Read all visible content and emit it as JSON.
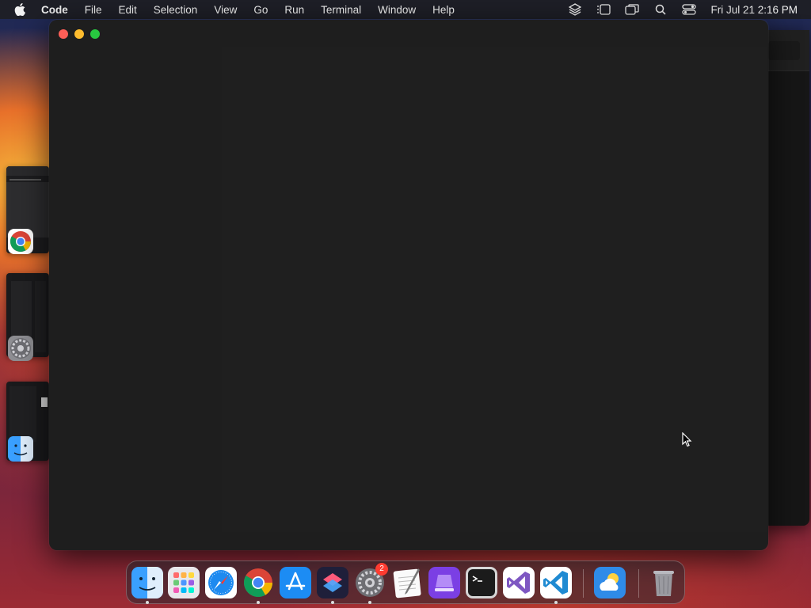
{
  "menubar": {
    "app_name": "Code",
    "items": [
      "File",
      "Edit",
      "Selection",
      "View",
      "Go",
      "Run",
      "Terminal",
      "Window",
      "Help"
    ],
    "clock": "Fri Jul 21  2:16 PM"
  },
  "dock": {
    "apps": [
      "Finder",
      "Launchpad",
      "Safari",
      "Google Chrome",
      "App Store",
      "Shortcuts",
      "System Settings",
      "TextEdit",
      "Apple Configurator",
      "Terminal",
      "Visual Studio",
      "Visual Studio Code",
      "Weather",
      "Trash"
    ],
    "system_settings_badge": "2"
  },
  "stage_manager": {
    "apps": [
      "Google Chrome",
      "System Settings",
      "Finder"
    ]
  }
}
